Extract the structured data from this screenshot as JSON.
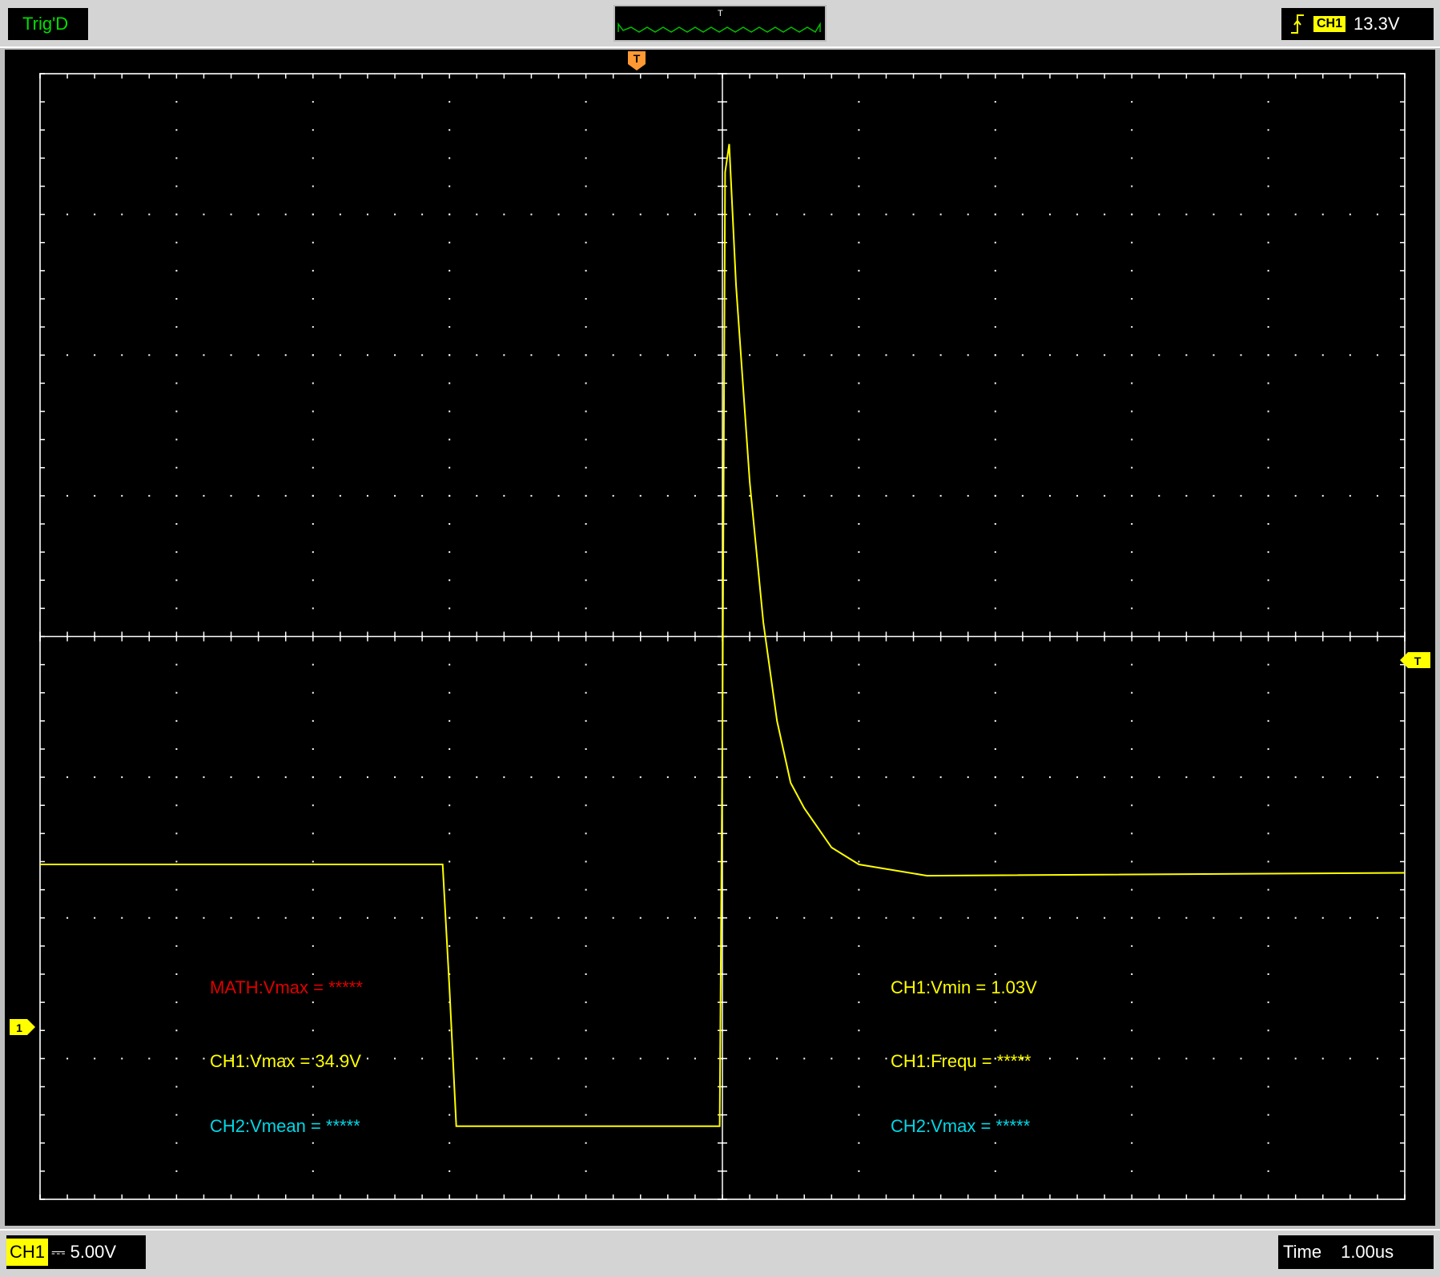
{
  "top": {
    "status": "Trig'D",
    "trigger_source": "CH1",
    "trigger_level": "13.3V",
    "trigger_marker": "T"
  },
  "bottom": {
    "channel_label": "CH1",
    "coupling_symbol": "⎓",
    "volts_per_div": "5.00V",
    "time_label": "Time",
    "time_per_div": "1.00us"
  },
  "markers": {
    "trigger_position": "T",
    "trigger_level": "T",
    "ch1_ground": "1"
  },
  "measurements": [
    {
      "text": "MATH:Vmax = *****",
      "color": "#e00000"
    },
    {
      "text": "CH1:Vmax = 34.9V",
      "color": "#ffff00"
    },
    {
      "text": "CH2:Vmean = *****",
      "color": "#00d8e8"
    },
    {
      "text": "CH1:Vmin = 1.03V",
      "color": "#ffff00"
    },
    {
      "text": "CH1:Frequ = *****",
      "color": "#ffff00"
    },
    {
      "text": "CH2:Vmax = *****",
      "color": "#00d8e8"
    }
  ],
  "colors": {
    "ch1": "#ffff00",
    "trigger": "#ff9933",
    "status_green": "#00e000",
    "grid": "#ffffff"
  },
  "chart_data": {
    "type": "line",
    "series": [
      {
        "name": "CH1",
        "x": [
          -5.0,
          -2.05,
          -2.0,
          -1.95,
          -0.02,
          0.0,
          0.02,
          0.05,
          0.1,
          0.2,
          0.3,
          0.4,
          0.5,
          0.6,
          0.8,
          1.0,
          1.5,
          5.0
        ],
        "y": [
          10.4,
          10.4,
          6.0,
          1.1,
          1.1,
          15.0,
          35.0,
          36.0,
          31.0,
          24.0,
          19.0,
          15.5,
          13.3,
          12.4,
          11.0,
          10.4,
          10.0,
          10.1
        ]
      }
    ],
    "xlim": [
      -5.0,
      5.0
    ],
    "ylim": [
      -1.5,
      38.5
    ],
    "x_units": "us",
    "y_units": "V",
    "grid": true
  }
}
